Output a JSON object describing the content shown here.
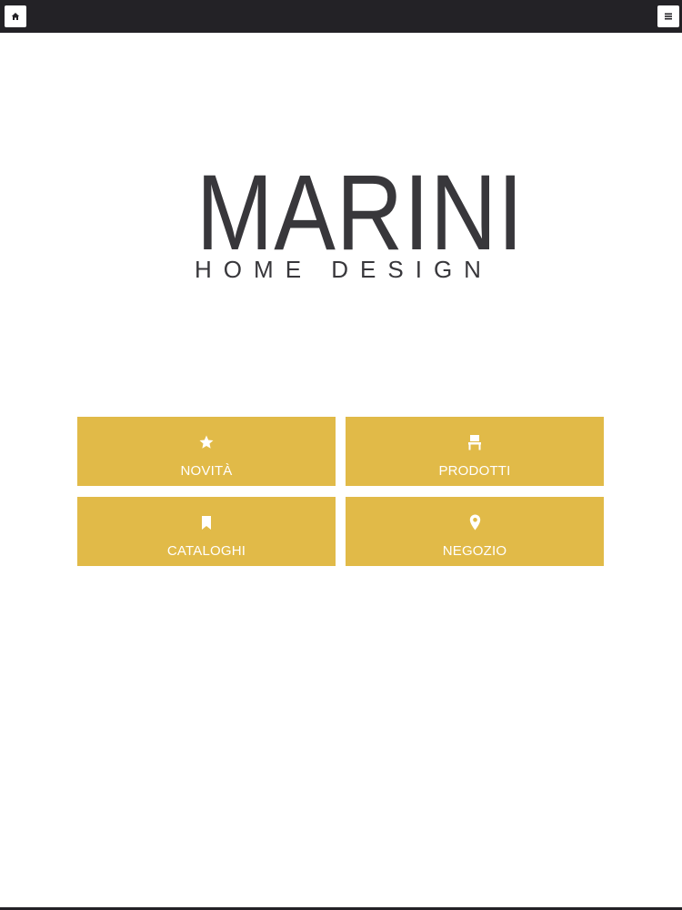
{
  "topbar": {
    "home_icon": "home-icon",
    "menu_icon": "hamburger-menu-icon"
  },
  "logo": {
    "title": "MARINI",
    "subtitle": "HOME DESIGN"
  },
  "tiles": [
    {
      "label": "NOVITÀ",
      "icon": "star-icon"
    },
    {
      "label": "PRODOTTI",
      "icon": "chair-icon"
    },
    {
      "label": "CATALOGHI",
      "icon": "bookmark-icon"
    },
    {
      "label": "NEGOZIO",
      "icon": "map-pin-icon"
    }
  ],
  "colors": {
    "topbar": "#232226",
    "tile": "#e1ba48",
    "logo": "#38373b",
    "tile_text": "#ffffff"
  }
}
